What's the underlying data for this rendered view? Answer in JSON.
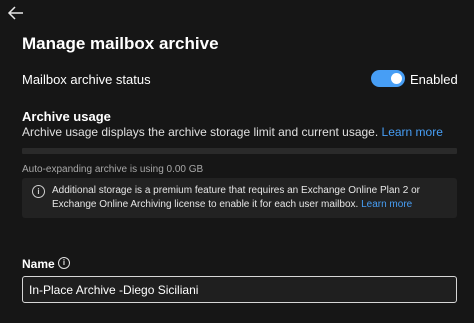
{
  "panel": {
    "back_icon": "arrow-left-icon",
    "title": "Manage mailbox archive"
  },
  "archive_status": {
    "label": "Mailbox archive status",
    "toggle_on": true,
    "toggle_text": "Enabled",
    "accent_color": "#479ef5"
  },
  "archive_usage": {
    "heading": "Archive usage",
    "description": "Archive usage displays the archive storage limit and current usage.",
    "learn_more": "Learn more",
    "usage_fraction": 0,
    "auto_expanding": "Auto-expanding archive is using 0.00 GB"
  },
  "info_message": {
    "icon": "info-icon",
    "line1": "Additional storage is a premium feature that requires an Exchange Online Plan 2 or",
    "line2": "Exchange Online Archiving license to enable it for each user mailbox.",
    "learn_more": "Learn more"
  },
  "name_field": {
    "label": "Name",
    "info_icon": "info-icon",
    "value": "In-Place Archive -Diego Siciliani"
  }
}
